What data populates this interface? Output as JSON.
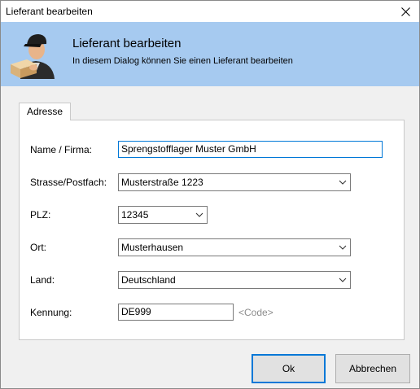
{
  "window": {
    "title": "Lieferant bearbeiten"
  },
  "header": {
    "title": "Lieferant bearbeiten",
    "subtitle": "In diesem Dialog können Sie einen Lieferant bearbeiten",
    "icon": "delivery-person-icon",
    "background_color": "#a6caf0"
  },
  "tabs": [
    {
      "label": "Adresse",
      "selected": true
    }
  ],
  "form": {
    "name": {
      "label": "Name / Firma:",
      "value": "Sprengstofflager Muster GmbH"
    },
    "street": {
      "label": "Strasse/Postfach:",
      "value": "Musterstraße 1223"
    },
    "plz": {
      "label": "PLZ:",
      "value": "12345"
    },
    "city": {
      "label": "Ort:",
      "value": "Musterhausen"
    },
    "country": {
      "label": "Land:",
      "value": "Deutschland"
    },
    "kennung": {
      "label": "Kennung:",
      "value": "DE999",
      "hint": "<Code>"
    }
  },
  "buttons": {
    "ok": "Ok",
    "cancel": "Abbrechen"
  },
  "colors": {
    "focus_accent": "#0078d7"
  }
}
